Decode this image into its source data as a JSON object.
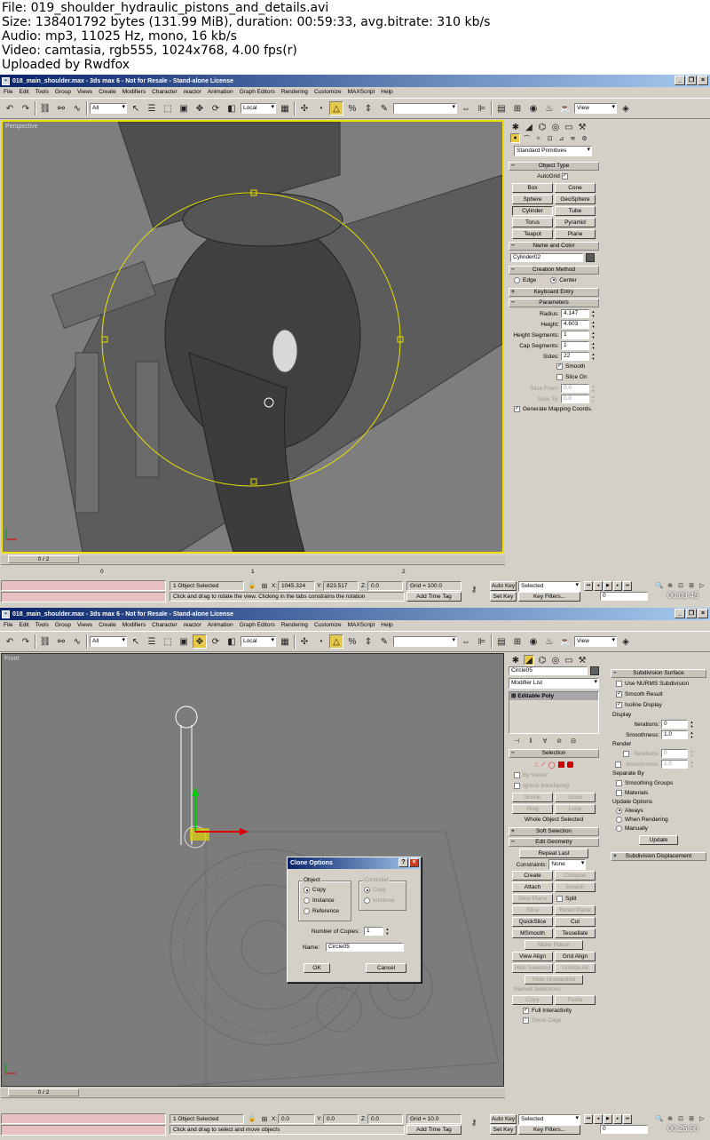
{
  "info": {
    "file": "File: 019_shoulder_hydraulic_pistons_and_details.avi",
    "size": "Size: 138401792 bytes (131.99 MiB), duration: 00:59:33, avg.bitrate: 310 kb/s",
    "audio": "Audio: mp3, 11025 Hz, mono, 16 kb/s",
    "video": "Video: camtasia, rgb555, 1024x768, 4.00 fps(r)",
    "uploader": "Uploaded by Rwdfox"
  },
  "app": {
    "title": "018_main_shoulder.max - 3ds max 6 - Not for Resale - Stand-alone License",
    "menu": [
      "File",
      "Edit",
      "Tools",
      "Group",
      "Views",
      "Create",
      "Modifiers",
      "Character",
      "reactor",
      "Animation",
      "Graph Editors",
      "Rendering",
      "Customize",
      "MAXScript",
      "Help"
    ],
    "selection_filter": "All",
    "ref_coord": "Local",
    "view_label": "View"
  },
  "frame1": {
    "viewport_label": "Perspective",
    "category_dropdown": "Standard Primitives",
    "object_type": {
      "rollout": "Object Type",
      "autogrid": "AutoGrid",
      "buttons": [
        "Box",
        "Cone",
        "Sphere",
        "GeoSphere",
        "Cylinder",
        "Tube",
        "Torus",
        "Pyramid",
        "Teapot",
        "Plane"
      ]
    },
    "name_color": {
      "rollout": "Name and Color",
      "name": "Cylinder02"
    },
    "creation_method": {
      "rollout": "Creation Method",
      "edge": "Edge",
      "center": "Center"
    },
    "keyboard_entry": "Keyboard Entry",
    "parameters": {
      "rollout": "Parameters",
      "radius_label": "Radius:",
      "radius": "4.147",
      "height_label": "Height:",
      "height": "4.603",
      "height_segments_label": "Height Segments:",
      "height_segments": "1",
      "cap_segments_label": "Cap Segments:",
      "cap_segments": "1",
      "sides_label": "Sides:",
      "sides": "22",
      "smooth": "Smooth",
      "slice_on": "Slice On",
      "slice_from_label": "Slice From:",
      "slice_from": "0.0",
      "slice_to_label": "Slice To:",
      "slice_to": "0.0",
      "gen_mapping": "Generate Mapping Coords."
    },
    "time_slider": "0 / 2",
    "ruler_ticks": [
      "0",
      "1",
      "2"
    ],
    "status": {
      "selected": "1 Object Selected",
      "prompt": "Click and drag to rotate the view.  Clicking in the tabs constrains the rotation",
      "x_label": "X:",
      "x": "1045.324",
      "y_label": "Y:",
      "y": "823.517",
      "z_label": "Z:",
      "z": "0.0",
      "grid": "Grid = 100.0",
      "add_time_tag": "Add Time Tag",
      "auto_key": "Auto Key",
      "set_key": "Set Key",
      "key_mode": "Selected",
      "key_filters": "Key Filters...",
      "frame": "0",
      "timestamp": "00:03:45"
    }
  },
  "frame2": {
    "viewport_label": "Front",
    "object_name": "Circle05",
    "modifier_list": "Modifier List",
    "stack_item": "Editable Poly",
    "selection": {
      "rollout": "Selection",
      "by_vertex": "By Vertex",
      "ignore_backfacing": "Ignore Backfacing",
      "shrink": "Shrink",
      "grow": "Grow",
      "ring": "Ring",
      "loop": "Loop",
      "summary": "Whole Object Selected"
    },
    "soft_selection": "Soft Selection",
    "edit_geometry": {
      "rollout": "Edit Geometry",
      "repeat_last": "Repeat Last",
      "constraints_label": "Constraints:",
      "constraints": "None",
      "create": "Create",
      "collapse": "Collapse",
      "attach": "Attach",
      "detach": "Detach",
      "slice_plane": "Slice Plane",
      "split": "Split",
      "slice": "Slice",
      "reset_plane": "Reset Plane",
      "quickslice": "QuickSlice",
      "cut": "Cut",
      "msmooth": "MSmooth",
      "tessellate": "Tessellate",
      "make_planar": "Make Planar",
      "view_align": "View Align",
      "grid_align": "Grid Align",
      "hide_selected": "Hide Selected",
      "unhide_all": "Unhide All",
      "hide_unselected": "Hide Unselected",
      "named_selections": "Named Selections:",
      "copy": "Copy",
      "paste": "Paste",
      "full_interactivity": "Full Interactivity",
      "show_cage": "Show Cage"
    },
    "subdivision": {
      "rollout": "Subdivision Surface",
      "use_nurms": "Use NURMS Subdivision",
      "smooth_result": "Smooth Result",
      "isoline": "Isoline Display",
      "display": "Display",
      "iterations_label": "Iterations:",
      "iterations": "0",
      "smoothness_label": "Smoothness:",
      "smoothness": "1.0",
      "render": "Render",
      "r_iterations_label": "Iterations:",
      "r_iterations": "0",
      "r_smoothness_label": "Smoothness:",
      "r_smoothness": "1.0",
      "separate_by": "Separate By",
      "smoothing_groups": "Smoothing Groups",
      "materials": "Materials",
      "update_options": "Update Options",
      "always": "Always",
      "when_rendering": "When Rendering",
      "manually": "Manually",
      "update": "Update",
      "displacement": "Subdivision Displacement"
    },
    "dialog": {
      "title": "Clone Options",
      "object_group": "Object",
      "copy": "Copy",
      "instance": "Instance",
      "reference": "Reference",
      "controller_group": "Controller",
      "c_copy": "Copy",
      "c_instance": "Instance",
      "copies_label": "Number of Copies:",
      "copies": "1",
      "name_label": "Name:",
      "name": "Circle05",
      "ok": "OK",
      "cancel": "Cancel"
    },
    "time_slider": "0 / 2",
    "status": {
      "selected": "1 Object Selected",
      "prompt": "Click and drag to select and move objects",
      "x_label": "X:",
      "x": "0.0",
      "y_label": "Y:",
      "y": "0.0",
      "z_label": "Z:",
      "z": "0.0",
      "grid": "Grid = 10.0",
      "add_time_tag": "Add Time Tag",
      "auto_key": "Auto Key",
      "set_key": "Set Key",
      "key_mode": "Selected",
      "key_filters": "Key Filters...",
      "frame": "0",
      "timestamp": "00:25:50"
    }
  },
  "colors": {
    "title_bar": "#0a246a",
    "viewport_bg": "#7f7f7f",
    "selection_yellow": "#f0e000",
    "status_pink": "#e8c0c4"
  }
}
